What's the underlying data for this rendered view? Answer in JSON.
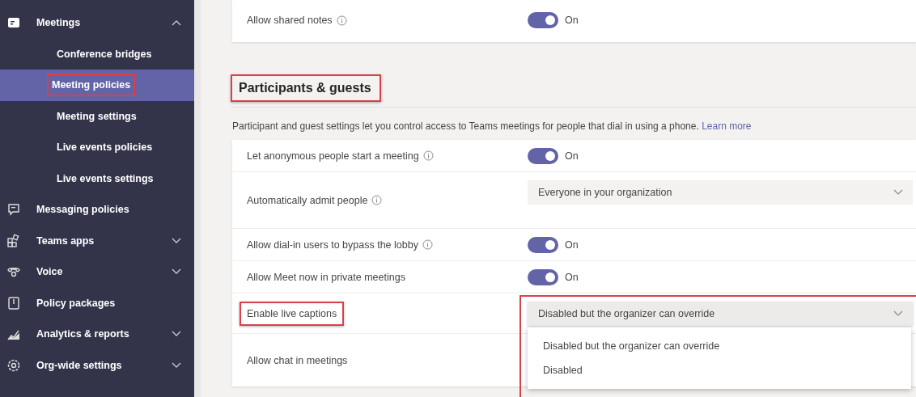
{
  "sidebar": {
    "items": [
      {
        "label": "Meetings",
        "selected": false,
        "expanded": true,
        "children": [
          {
            "label": "Conference bridges",
            "selected": false,
            "highlighted": false
          },
          {
            "label": "Meeting policies",
            "selected": true,
            "highlighted": true
          },
          {
            "label": "Meeting settings",
            "selected": false,
            "highlighted": false
          },
          {
            "label": "Live events policies",
            "selected": false,
            "highlighted": false
          },
          {
            "label": "Live events settings",
            "selected": false,
            "highlighted": false
          }
        ]
      },
      {
        "label": "Messaging policies",
        "selected": false
      },
      {
        "label": "Teams apps",
        "selected": false,
        "expanded": false
      },
      {
        "label": "Voice",
        "selected": false,
        "expanded": false
      },
      {
        "label": "Policy packages",
        "selected": false
      },
      {
        "label": "Analytics & reports",
        "selected": false,
        "expanded": false
      },
      {
        "label": "Org-wide settings",
        "selected": false,
        "expanded": false
      }
    ]
  },
  "top_card": {
    "rows": [
      {
        "kind": "toggle",
        "label": "Allow shared notes",
        "info": true,
        "highlighted": false,
        "on": true,
        "state_text": "On"
      }
    ]
  },
  "section": {
    "title": "Participants & guests",
    "highlighted": true,
    "description": "Participant and guest settings let you control access to Teams meetings for people that dial in using a phone.",
    "link": "Learn more"
  },
  "settings": {
    "rows": [
      {
        "kind": "toggle",
        "label": "Let anonymous people start a meeting",
        "info": true,
        "highlighted": false,
        "on": true,
        "state_text": "On"
      },
      {
        "kind": "dropdown",
        "label": "Automatically admit people",
        "info": true,
        "highlighted": false,
        "value": "Everyone in your organization",
        "expanded": false,
        "control_highlighted": false
      },
      {
        "kind": "toggle",
        "label": "Allow dial-in users to bypass the lobby",
        "info": true,
        "highlighted": false,
        "on": true,
        "state_text": "On"
      },
      {
        "kind": "toggle",
        "label": "Allow Meet now in private meetings",
        "info": false,
        "highlighted": false,
        "on": true,
        "state_text": "On"
      },
      {
        "kind": "dropdown",
        "label": "Enable live captions",
        "info": false,
        "highlighted": true,
        "value": "Disabled but the organizer can override",
        "expanded": true,
        "control_highlighted": true,
        "options": [
          "Disabled but the organizer can override",
          "Disabled"
        ]
      },
      {
        "kind": "label",
        "label": "Allow chat in meetings",
        "info": false,
        "highlighted": false
      }
    ]
  }
}
